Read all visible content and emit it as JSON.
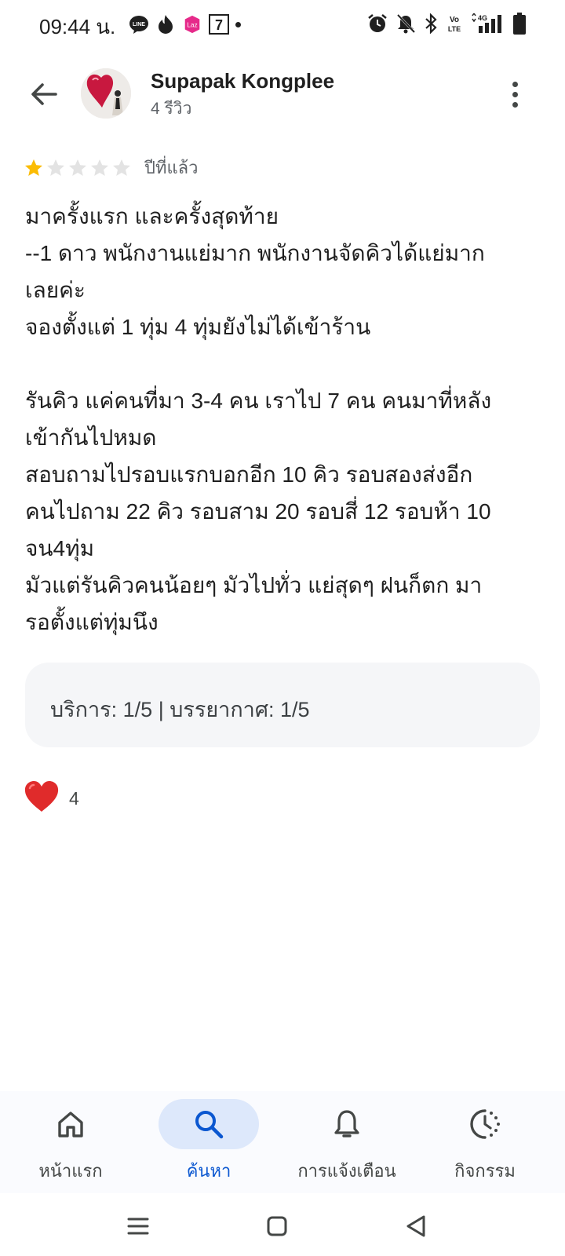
{
  "status_bar": {
    "time": "09:44 น.",
    "left_icons": [
      "line-icon",
      "tinder-icon",
      "lazada-icon",
      "7-eleven-icon"
    ],
    "right_icons": [
      "alarm-icon",
      "mute-icon",
      "bluetooth-icon",
      "volte-icon",
      "4g-signal-icon",
      "battery-icon"
    ]
  },
  "header": {
    "user_name": "Supapak Kongplee",
    "review_count": "4 รีวิว"
  },
  "review": {
    "rating": 1,
    "rating_max": 5,
    "time_ago": "ปีที่แล้ว",
    "lines": [
      "มาครั้งแรก และครั้งสุดท้าย",
      "--1 ดาว พนักงานแย่มาก พนักงานจัดคิวได้แย่มาก",
      "เลยค่ะ",
      "จองตั้งแต่ 1 ทุ่ม 4 ทุ่มยังไม่ได้เข้าร้าน",
      "",
      "รันคิว แค่คนที่มา 3-4 คน เราไป 7 คน คนมาที่หลัง",
      "เข้ากันไปหมด",
      "สอบถามไปรอบแรกบอกอีก 10 คิว รอบสองส่งอีก",
      "คนไปถาม 22 คิว รอบสาม 20 รอบสี่ 12 รอบห้า 10",
      "จน4ทุ่ม",
      "มัวแต่รันคิวคนน้อยๆ มัวไปทั่ว แย่สุดๆ ฝนก็ตก มา",
      "รอตั้งแต่ทุ่มนึง"
    ],
    "attributes": "บริการ: 1/5  |  บรรยากาศ: 1/5",
    "likes": "4"
  },
  "bottom_nav": {
    "items": [
      {
        "label": "หน้าแรก",
        "icon": "home-icon"
      },
      {
        "label": "ค้นหา",
        "icon": "search-icon"
      },
      {
        "label": "การแจ้งเตือน",
        "icon": "bell-icon"
      },
      {
        "label": "กิจกรรม",
        "icon": "activity-icon"
      }
    ],
    "active_index": 1
  },
  "colors": {
    "star_filled": "#fbbc04",
    "star_empty": "#e3e3e3",
    "active_nav": "#0b57d0",
    "active_pill": "#dde8fb",
    "heart": "#e02b2b"
  }
}
